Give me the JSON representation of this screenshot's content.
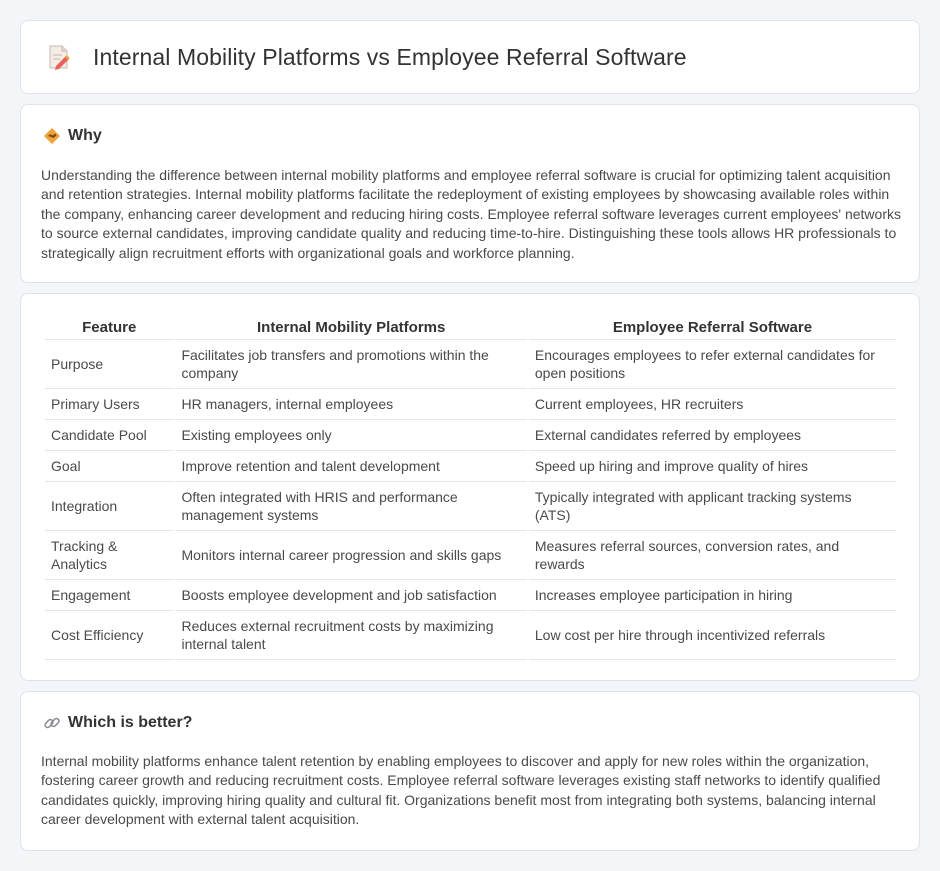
{
  "page": {
    "title": "Internal Mobility Platforms vs Employee Referral Software",
    "title_icon": "document-pencil-icon"
  },
  "why": {
    "icon": "handshake-icon",
    "heading": "Why",
    "text": "Understanding the difference between internal mobility platforms and employee referral software is crucial for optimizing talent acquisition and retention strategies. Internal mobility platforms facilitate the redeployment of existing employees by showcasing available roles within the company, enhancing career development and reducing hiring costs. Employee referral software leverages current employees' networks to source external candidates, improving candidate quality and reducing time-to-hire. Distinguishing these tools allows HR professionals to strategically align recruitment efforts with organizational goals and workforce planning."
  },
  "comparison": {
    "headers": [
      "Feature",
      "Internal Mobility Platforms",
      "Employee Referral Software"
    ],
    "rows": [
      [
        "Purpose",
        "Facilitates job transfers and promotions within the company",
        "Encourages employees to refer external candidates for open positions"
      ],
      [
        "Primary Users",
        "HR managers, internal employees",
        "Current employees, HR recruiters"
      ],
      [
        "Candidate Pool",
        "Existing employees only",
        "External candidates referred by employees"
      ],
      [
        "Goal",
        "Improve retention and talent development",
        "Speed up hiring and improve quality of hires"
      ],
      [
        "Integration",
        "Often integrated with HRIS and performance management systems",
        "Typically integrated with applicant tracking systems (ATS)"
      ],
      [
        "Tracking & Analytics",
        "Monitors internal career progression and skills gaps",
        "Measures referral sources, conversion rates, and rewards"
      ],
      [
        "Engagement",
        "Boosts employee development and job satisfaction",
        "Increases employee participation in hiring"
      ],
      [
        "Cost Efficiency",
        "Reduces external recruitment costs by maximizing internal talent",
        "Low cost per hire through incentivized referrals"
      ]
    ]
  },
  "better": {
    "icon": "link-icon",
    "heading": "Which is better?",
    "text": "Internal mobility platforms enhance talent retention by enabling employees to discover and apply for new roles within the organization, fostering career growth and reducing recruitment costs. Employee referral software leverages existing staff networks to identify qualified candidates quickly, improving hiring quality and cultural fit. Organizations benefit most from integrating both systems, balancing internal career development with external talent acquisition."
  },
  "colors": {
    "background": "#f3f5f9",
    "card": "#ffffff",
    "border": "#dfe3ea",
    "accent_orange": "#f0a23a"
  }
}
